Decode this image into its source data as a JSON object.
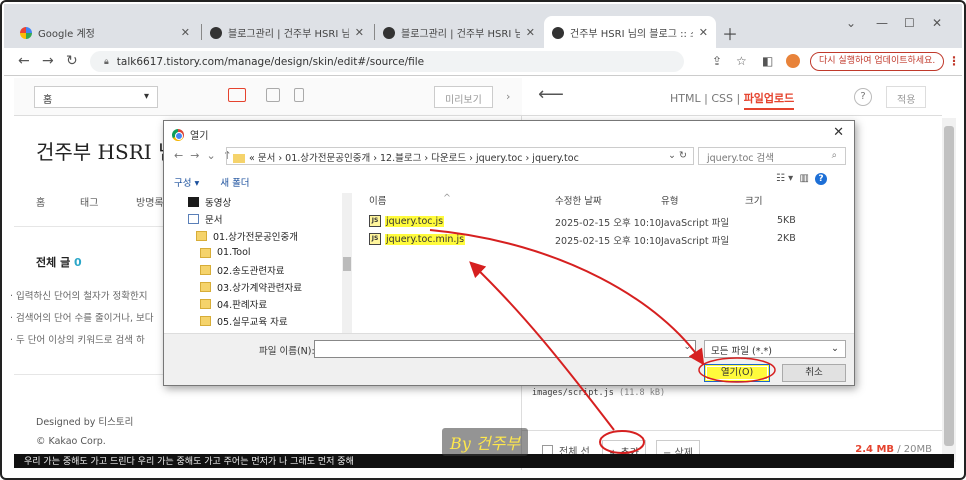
{
  "browser": {
    "tabs": [
      {
        "title": "Google 계정",
        "icon": "google-icon"
      },
      {
        "title": "블로그관리 | 건주부 HSRI 님의 :",
        "icon": "tistory-icon"
      },
      {
        "title": "블로그관리 | 건주부 HSRI 님의 :",
        "icon": "tistory-icon"
      },
      {
        "title": "건주부 HSRI 님의 블로그 :: 스킨",
        "icon": "tistory-icon"
      }
    ],
    "url": "talk6617.tistory.com/manage/design/skin/edit#/source/file",
    "update_button": "다시 실행하여 업데이트하세요."
  },
  "preview": {
    "page_select": "홈",
    "preview_button": "미리보기",
    "blog_title": "건주부 HSRI 님",
    "nav": [
      "홈",
      "태그",
      "방명록"
    ],
    "all_posts_label": "전체 글",
    "all_posts_count": "0",
    "search_tips": [
      "· 입력하신 단어의 철자가 정확한지",
      "· 검색어의 단어 수를 줄이거나, 보다",
      "· 두 단어 이상의 키워드로 검색 하"
    ],
    "designed_by": "Designed by 티스토리",
    "copyright": "© Kakao Corp."
  },
  "editor": {
    "tabs": [
      "HTML",
      "CSS",
      "파일업로드"
    ],
    "active_tab": "파일업로드",
    "help": "?",
    "apply_button": "적용",
    "file_name": "images/script.js",
    "file_size": "(11.8 kB)",
    "select_all": "전체 선",
    "add_button": "+ 추가",
    "delete_button": "− 삭제",
    "usage_used": "2.4 MB",
    "usage_total": "/ 20MB"
  },
  "watermark": "By 건주부",
  "bottom_text": "우리 가는 중해도 가고 드린다 우리 가는 중해도 가고 주어는 먼저가 나 그래도 먼저 중해",
  "dialog": {
    "title": "열기",
    "path": "« 문서 › 01.상가전문공인중개 › 12.블로그 › 다운로드 › jquery.toc › jquery.toc",
    "search_placeholder": "jquery.toc 검색",
    "organize": "구성 ▾",
    "new_folder": "새 폴더",
    "tree": [
      {
        "label": "동영상",
        "icon": "video",
        "indent": 0
      },
      {
        "label": "문서",
        "icon": "doc",
        "indent": 0
      },
      {
        "label": "01.상가전문공인중개",
        "icon": "folder",
        "indent": 1
      },
      {
        "label": "01.Tool",
        "icon": "folder",
        "indent": 2
      },
      {
        "label": "02.송도관련자료",
        "icon": "folder",
        "indent": 2
      },
      {
        "label": "03.상가계약관련자료",
        "icon": "folder",
        "indent": 2
      },
      {
        "label": "04.판례자료",
        "icon": "folder",
        "indent": 2
      },
      {
        "label": "05.실무교육 자료",
        "icon": "folder",
        "indent": 2
      }
    ],
    "columns": [
      "이름",
      "수정한 날짜",
      "유형",
      "크기"
    ],
    "files": [
      {
        "name": "jquery.toc.js",
        "date": "2025-02-15 오후 10:10",
        "type": "JavaScript 파일",
        "size": "5KB"
      },
      {
        "name": "jquery.toc.min.js",
        "date": "2025-02-15 오후 10:10",
        "type": "JavaScript 파일",
        "size": "2KB"
      }
    ],
    "filename_label": "파일 이름(N):",
    "filename_value": "",
    "filetype": "모든 파일 (*.*)",
    "open_button": "열기(O)",
    "cancel_button": "취소"
  },
  "colors": {
    "accent": "#e5432e",
    "highlight": "#fffb3c",
    "annotation": "#d62020"
  }
}
